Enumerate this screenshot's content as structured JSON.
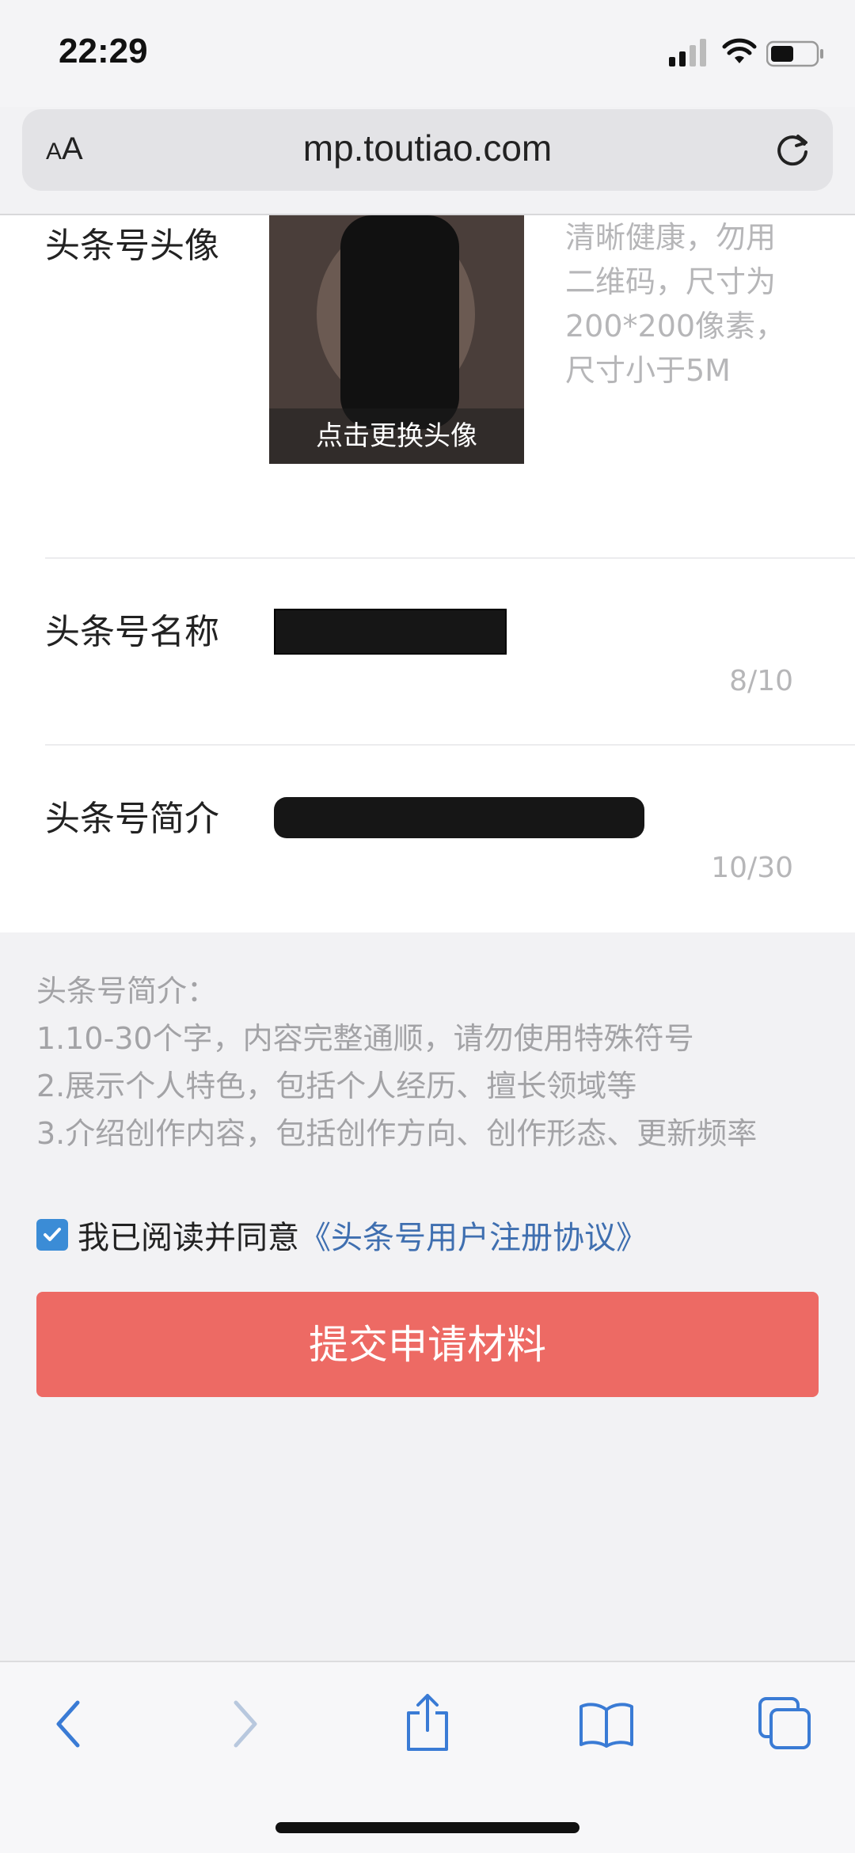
{
  "status": {
    "time": "22:29"
  },
  "browser": {
    "text_size_label_small": "A",
    "text_size_label_large": "A",
    "url": "mp.toutiao.com"
  },
  "form": {
    "avatar": {
      "label": "头条号头像",
      "change_label": "点击更换头像",
      "hint": "清晰健康，勿用二维码，尺寸为200*200像素，尺寸小于5M"
    },
    "name": {
      "label": "头条号名称",
      "counter": "8/10"
    },
    "intro": {
      "label": "头条号简介",
      "counter": "10/30"
    }
  },
  "tips": {
    "title": "头条号简介：",
    "items": [
      "1.10-30个字，内容完整通顺，请勿使用特殊符号",
      "2.展示个人特色，包括个人经历、擅长领域等",
      "3.介绍创作内容，包括创作方向、创作形态、更新频率"
    ]
  },
  "agreement": {
    "text": "我已阅读并同意",
    "link": "《头条号用户注册协议》",
    "checked": true
  },
  "submit_label": "提交申请材料",
  "colors": {
    "accent": "#ed6a64",
    "link": "#3f6fb0",
    "checkbox": "#3b8cd6",
    "toolbar_icon": "#3a7bd5"
  }
}
